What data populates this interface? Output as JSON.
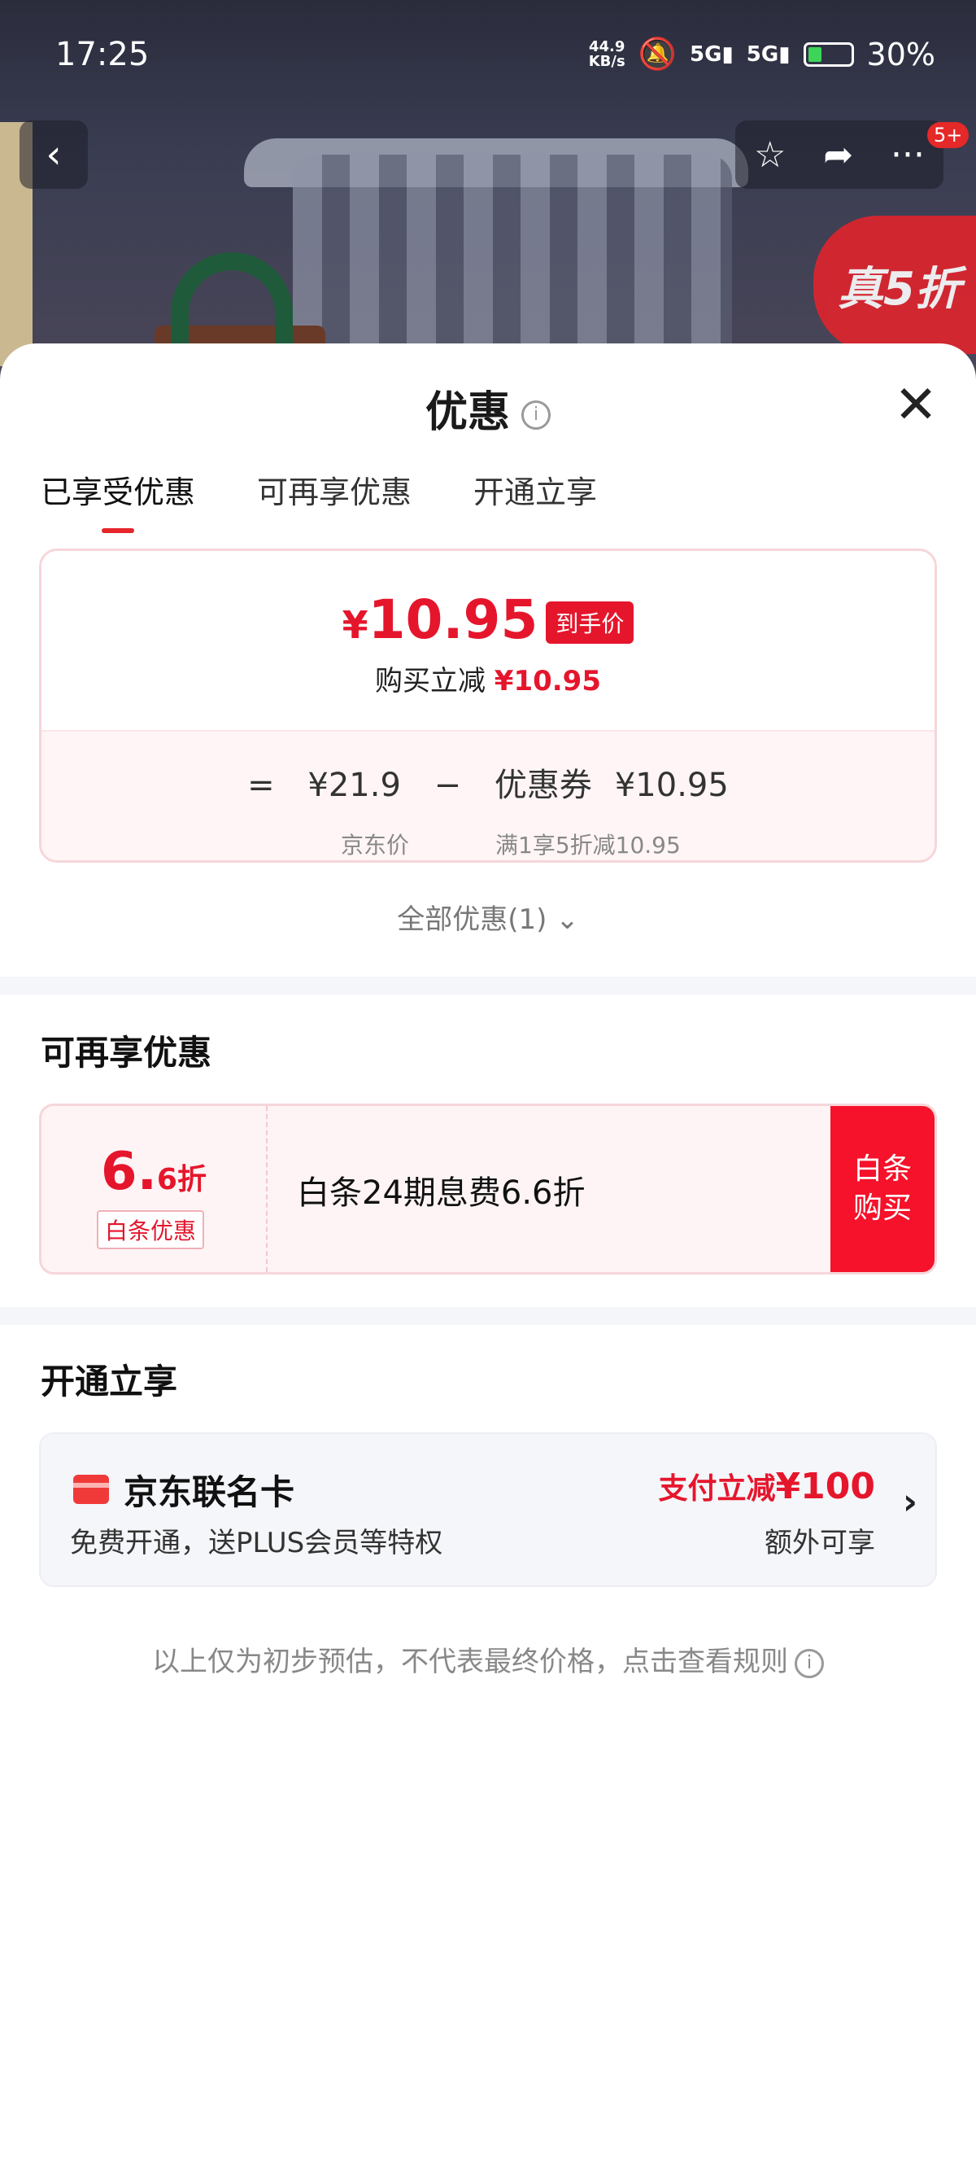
{
  "status_bar": {
    "time": "17:25",
    "net_speed_top": "44.9",
    "net_speed_unit": "KB/s",
    "signal1": "5G",
    "signal2": "5G",
    "battery": "30%"
  },
  "header": {
    "badge": "5+",
    "promo_tag": "真5折"
  },
  "sheet": {
    "title": "优惠",
    "tabs": [
      "已享受优惠",
      "可再享优惠",
      "开通立享"
    ],
    "enjoyed": {
      "yen": "¥",
      "price": "10.95",
      "price_tag": "到手价",
      "reduce_label": "购买立减",
      "reduce_value": "¥10.95",
      "eq": "=",
      "jd_price": "¥21.9",
      "minus": "−",
      "coupon_label": "优惠券",
      "coupon_value": "¥10.95",
      "jd_price_label": "京东价",
      "coupon_desc": "满1享5折减10.95"
    },
    "all_offers": "全部优惠(1)",
    "more_section": {
      "title": "可再享优惠",
      "baitiao": {
        "disc_big": "6.",
        "disc_small": "6折",
        "label": "白条优惠",
        "desc": "白条24期息费6.6折",
        "button_line1": "白条",
        "button_line2": "购买"
      }
    },
    "open_section": {
      "title": "开通立享",
      "card": {
        "name": "京东联名卡",
        "desc": "免费开通，送PLUS会员等特权",
        "reduce_label": "支付立减",
        "reduce_amount": "¥100",
        "extra": "额外可享"
      }
    },
    "disclaimer": "以上仅为初步预估，不代表最终价格，点击查看规则"
  },
  "colors": {
    "accent": "#e5162c",
    "button_red": "#f5122a",
    "card_bg": "#f5f6fa"
  }
}
